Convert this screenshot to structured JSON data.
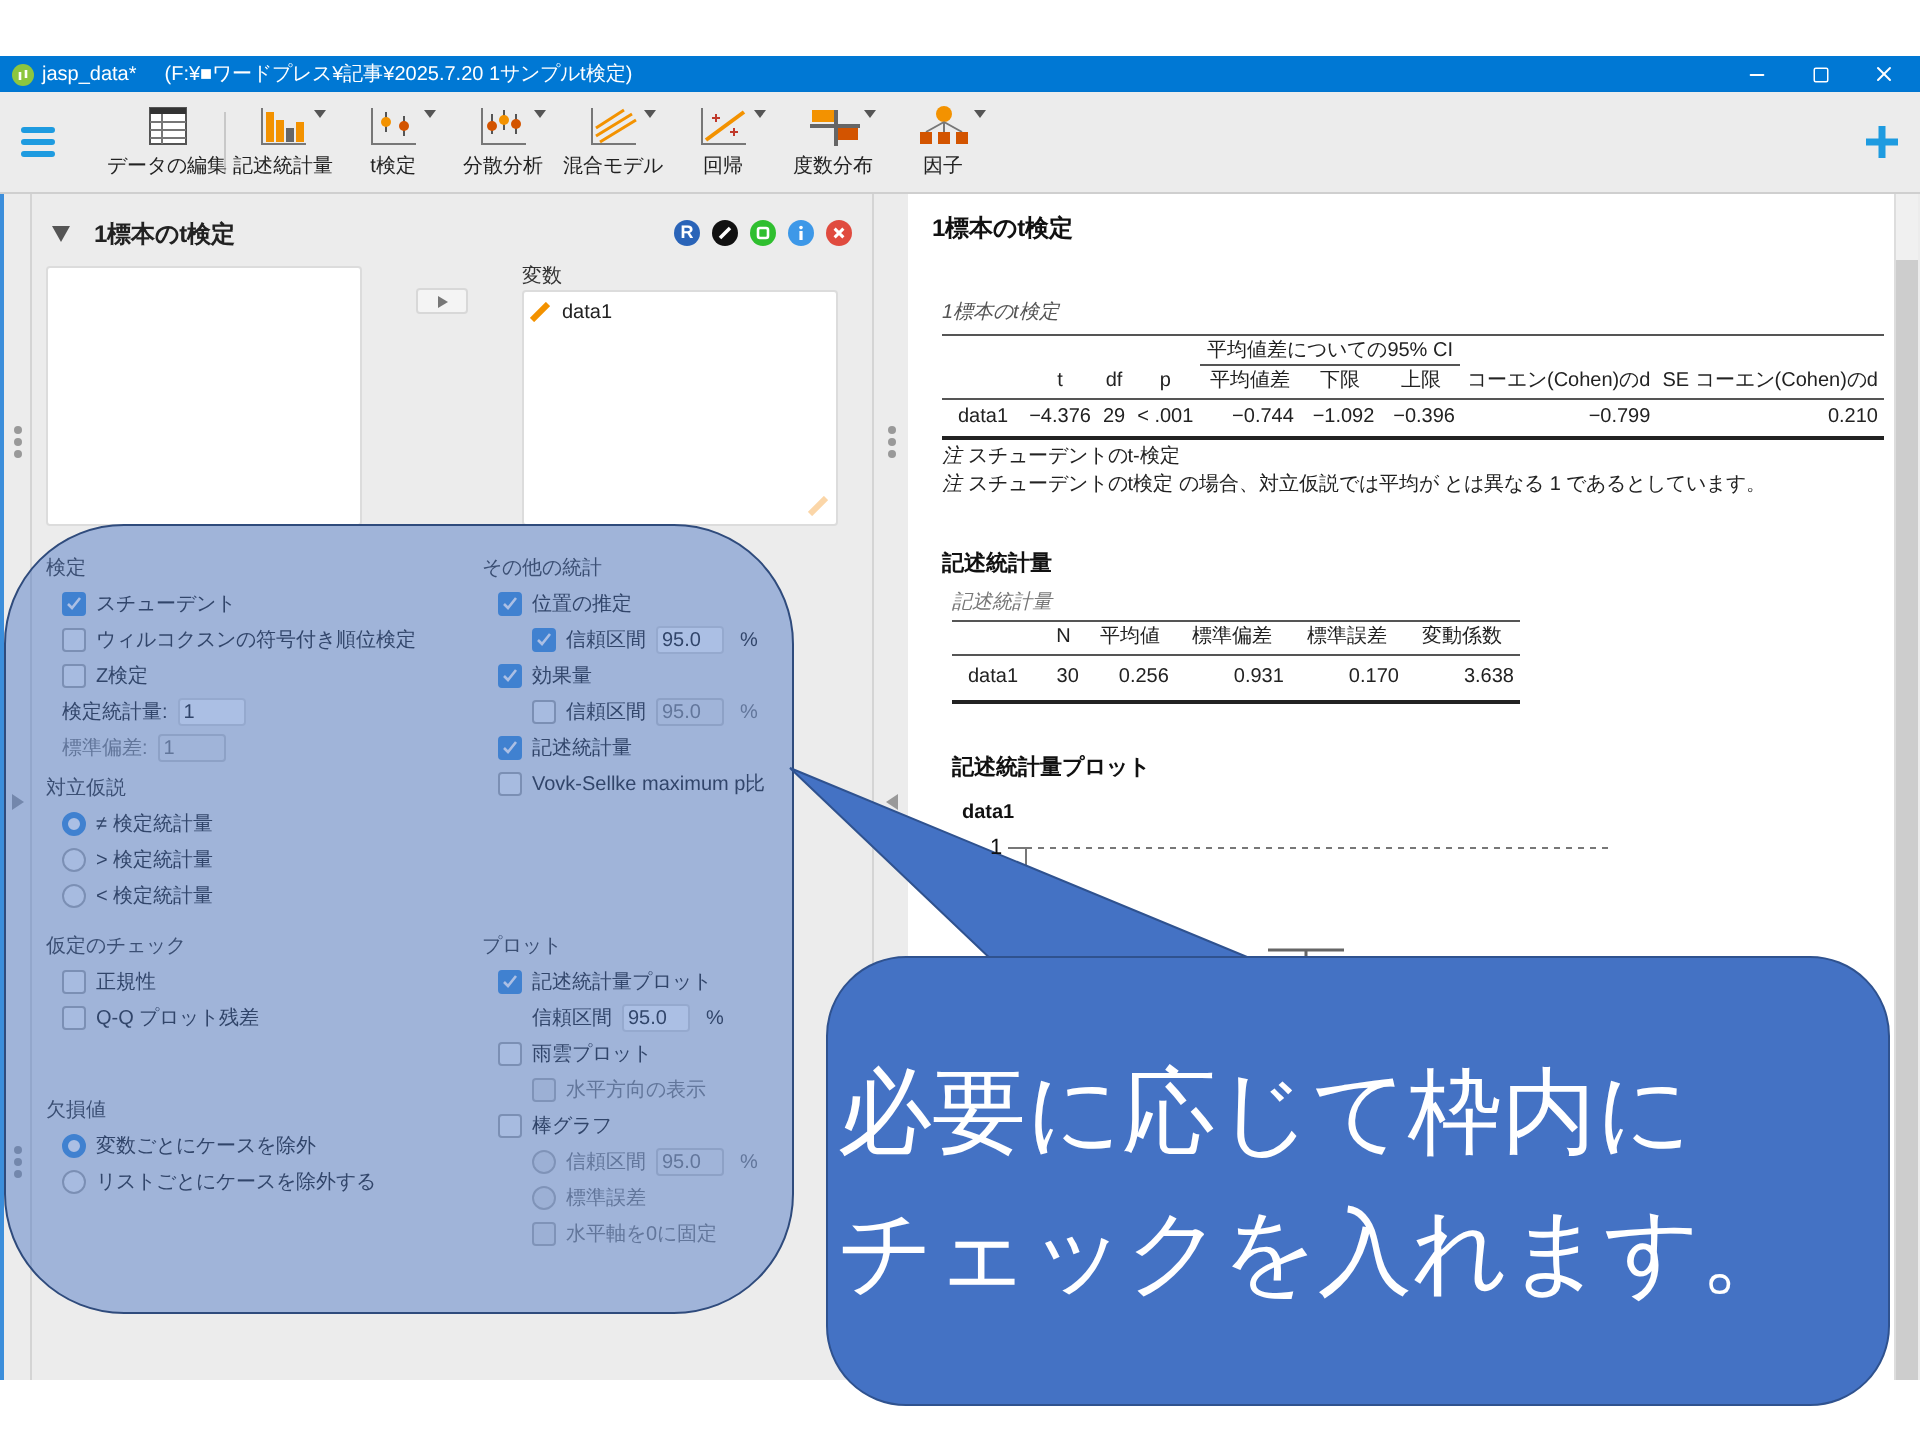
{
  "window": {
    "title": "jasp_data*",
    "path": "(F:¥■ワードプレス¥記事¥2025.7.20 1サンプルt検定)"
  },
  "toolbar": {
    "items": [
      {
        "kind": "table",
        "label": "データの編集",
        "dropdown": false
      },
      {
        "kind": "bars",
        "label": "記述統計量",
        "dropdown": true
      },
      {
        "kind": "ttest",
        "label": "t検定",
        "dropdown": true
      },
      {
        "kind": "anova",
        "label": "分散分析",
        "dropdown": true
      },
      {
        "kind": "mixed",
        "label": "混合モデル",
        "dropdown": true
      },
      {
        "kind": "regression",
        "label": "回帰",
        "dropdown": true
      },
      {
        "kind": "frequency",
        "label": "度数分布",
        "dropdown": true
      },
      {
        "kind": "factor",
        "label": "因子",
        "dropdown": true
      }
    ]
  },
  "analysis": {
    "title": "1標本のt検定",
    "expanded": true,
    "r_label": "R",
    "variables_label": "変数",
    "variables": [
      "data1"
    ],
    "option_rows": [
      {
        "left": [
          {
            "heading": "検定",
            "items": [
              {
                "kind": "checkbox",
                "label": "スチューデント",
                "checked": true,
                "disabled": false
              },
              {
                "kind": "checkbox",
                "label": "ウィルコクスンの符号付き順位検定",
                "checked": false,
                "disabled": false
              },
              {
                "kind": "checkbox",
                "label": "Z検定",
                "checked": false,
                "disabled": false
              },
              {
                "kind": "field",
                "label": "検定統計量:",
                "value": "1",
                "disabled": false
              },
              {
                "kind": "field",
                "label": "標準偏差:",
                "value": "1",
                "disabled": true
              }
            ]
          },
          {
            "heading": "対立仮説",
            "items": [
              {
                "kind": "radio",
                "label": "≠ 検定統計量",
                "selected": true,
                "disabled": false
              },
              {
                "kind": "radio",
                "label": "> 検定統計量",
                "selected": false,
                "disabled": false
              },
              {
                "kind": "radio",
                "label": "< 検定統計量",
                "selected": false,
                "disabled": false
              }
            ]
          }
        ],
        "right": [
          {
            "heading": "その他の統計",
            "items": [
              {
                "kind": "checkbox",
                "label": "位置の推定",
                "checked": true,
                "disabled": false,
                "children": [
                  {
                    "kind": "checkbox",
                    "label": "信頼区間",
                    "checked": true,
                    "disabled": false,
                    "value": "95.0",
                    "suffix": "%"
                  }
                ]
              },
              {
                "kind": "checkbox",
                "label": "効果量",
                "checked": true,
                "disabled": false,
                "children": [
                  {
                    "kind": "checkbox",
                    "label": "信頼区間",
                    "checked": false,
                    "disabled": false,
                    "value": "95.0",
                    "suffix": "%"
                  }
                ]
              },
              {
                "kind": "checkbox",
                "label": "記述統計量",
                "checked": true,
                "disabled": false
              },
              {
                "kind": "checkbox",
                "label": "Vovk-Sellke maximum p比",
                "checked": false,
                "disabled": false
              }
            ]
          }
        ]
      },
      {
        "left": [
          {
            "heading": "仮定のチェック",
            "items": [
              {
                "kind": "checkbox",
                "label": "正規性",
                "checked": false,
                "disabled": false
              },
              {
                "kind": "checkbox",
                "label": "Q-Q プロット残差",
                "checked": false,
                "disabled": false
              }
            ]
          },
          {
            "heading": "欠損値",
            "items": [
              {
                "kind": "radio",
                "label": "変数ごとにケースを除外",
                "selected": true,
                "disabled": false
              },
              {
                "kind": "radio",
                "label": "リストごとにケースを除外する",
                "selected": false,
                "disabled": false
              }
            ]
          }
        ],
        "right": [
          {
            "heading": "プロット",
            "items": [
              {
                "kind": "checkbox",
                "label": "記述統計量プロット",
                "checked": true,
                "disabled": false,
                "children": [
                  {
                    "kind": "field",
                    "label": "信頼区間",
                    "value": "95.0",
                    "suffix": "%",
                    "disabled": false
                  }
                ]
              },
              {
                "kind": "checkbox",
                "label": "雨雲プロット",
                "checked": false,
                "disabled": false,
                "children": [
                  {
                    "kind": "checkbox",
                    "label": "水平方向の表示",
                    "checked": false,
                    "disabled": true
                  }
                ]
              },
              {
                "kind": "checkbox",
                "label": "棒グラフ",
                "checked": false,
                "disabled": false,
                "children": [
                  {
                    "kind": "radio",
                    "label": "信頼区間",
                    "selected": false,
                    "disabled": true,
                    "value": "95.0",
                    "suffix": "%"
                  },
                  {
                    "kind": "radio",
                    "label": "標準誤差",
                    "selected": false,
                    "disabled": true
                  },
                  {
                    "kind": "checkbox",
                    "label": "水平軸を0に固定",
                    "checked": false,
                    "disabled": true
                  }
                ]
              }
            ]
          }
        ]
      }
    ]
  },
  "results": {
    "title": "1標本のt検定",
    "ttest_table": {
      "caption": "1標本のt検定",
      "group_header": "平均値差についての95% CI",
      "columns": [
        "",
        "t",
        "df",
        "p",
        "平均値差",
        "下限",
        "上限",
        "コーエン(Cohen)のd",
        "SE コーエン(Cohen)のd"
      ],
      "rows": [
        {
          "cells": [
            "data1",
            "−4.376",
            "29",
            "< .001",
            "−0.744",
            "−1.092",
            "−0.396",
            "−0.799",
            "0.210"
          ]
        }
      ],
      "notes": [
        "*注* スチューデントのt-検定",
        "*注* スチューデントのt検定 の場合、対立仮説では平均が とは異なる 1 であるとしています。"
      ]
    },
    "descriptives": {
      "heading": "記述統計量",
      "caption": "記述統計量",
      "columns": [
        "",
        "N",
        "平均値",
        "標準偏差",
        "標準誤差",
        "変動係数"
      ],
      "rows": [
        {
          "cells": [
            "data1",
            "30",
            "0.256",
            "0.931",
            "0.170",
            "3.638"
          ]
        }
      ]
    },
    "plot": {
      "heading": "記述統計量プロット",
      "title": "data1",
      "y_tick": "1"
    }
  },
  "callout": {
    "lines": [
      "必要に応じて枠内に",
      "チェックを入れます。"
    ]
  }
}
